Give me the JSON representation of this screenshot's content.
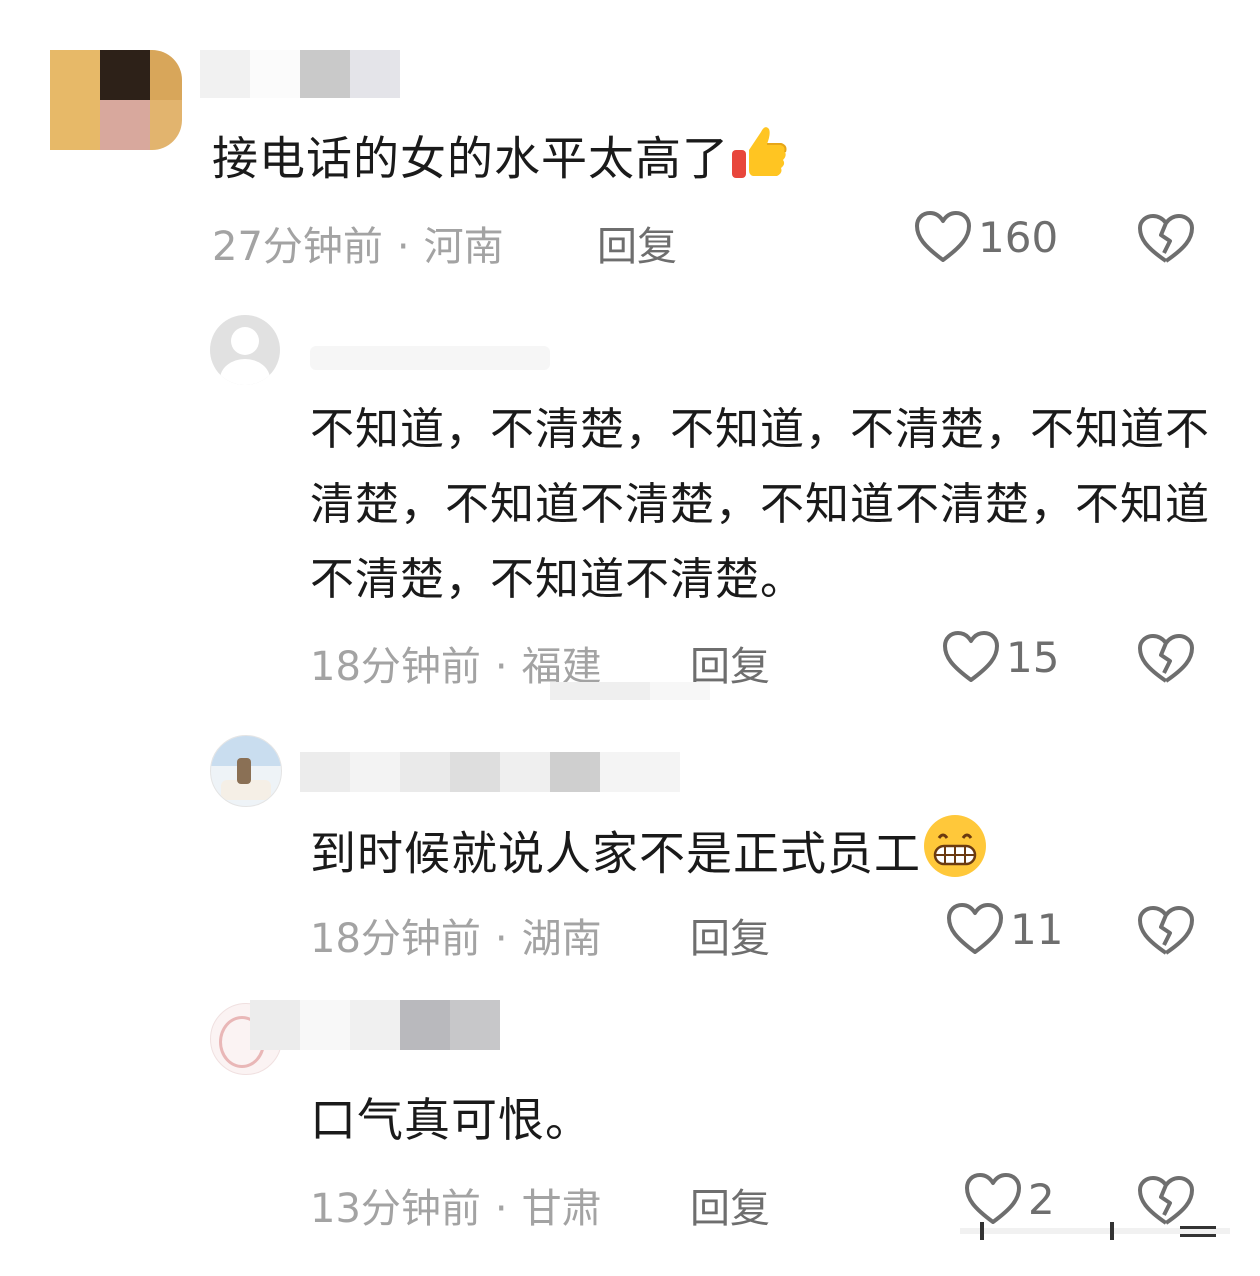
{
  "comments": [
    {
      "text": "接电话的女的水平太高了",
      "emoji": "thumbs-up",
      "time": "27分钟前",
      "region": "河南",
      "reply_label": "回复",
      "likes": "160"
    },
    {
      "text": "不知道，不清楚，不知道，不清楚，不知道不清楚，不知道不清楚，不知道不清楚，不知道不清楚，不知道不清楚。",
      "time": "18分钟前",
      "region": "福建",
      "reply_label": "回复",
      "likes": "15"
    },
    {
      "text": "到时候就说人家不是正式员工",
      "emoji": "grinning-face",
      "time": "18分钟前",
      "region": "湖南",
      "reply_label": "回复",
      "likes": "11"
    },
    {
      "text": "口气真可恨。",
      "time": "13分钟前",
      "region": "甘肃",
      "reply_label": "回复",
      "likes": "2"
    }
  ],
  "separator": "·",
  "colors": {
    "text": "#1a1a1a",
    "meta": "#a3a3a3",
    "action": "#6e6e6e"
  },
  "icons": [
    "heart-icon",
    "broken-heart-icon",
    "thumbs-up-emoji",
    "grinning-face-emoji",
    "default-avatar-icon"
  ]
}
